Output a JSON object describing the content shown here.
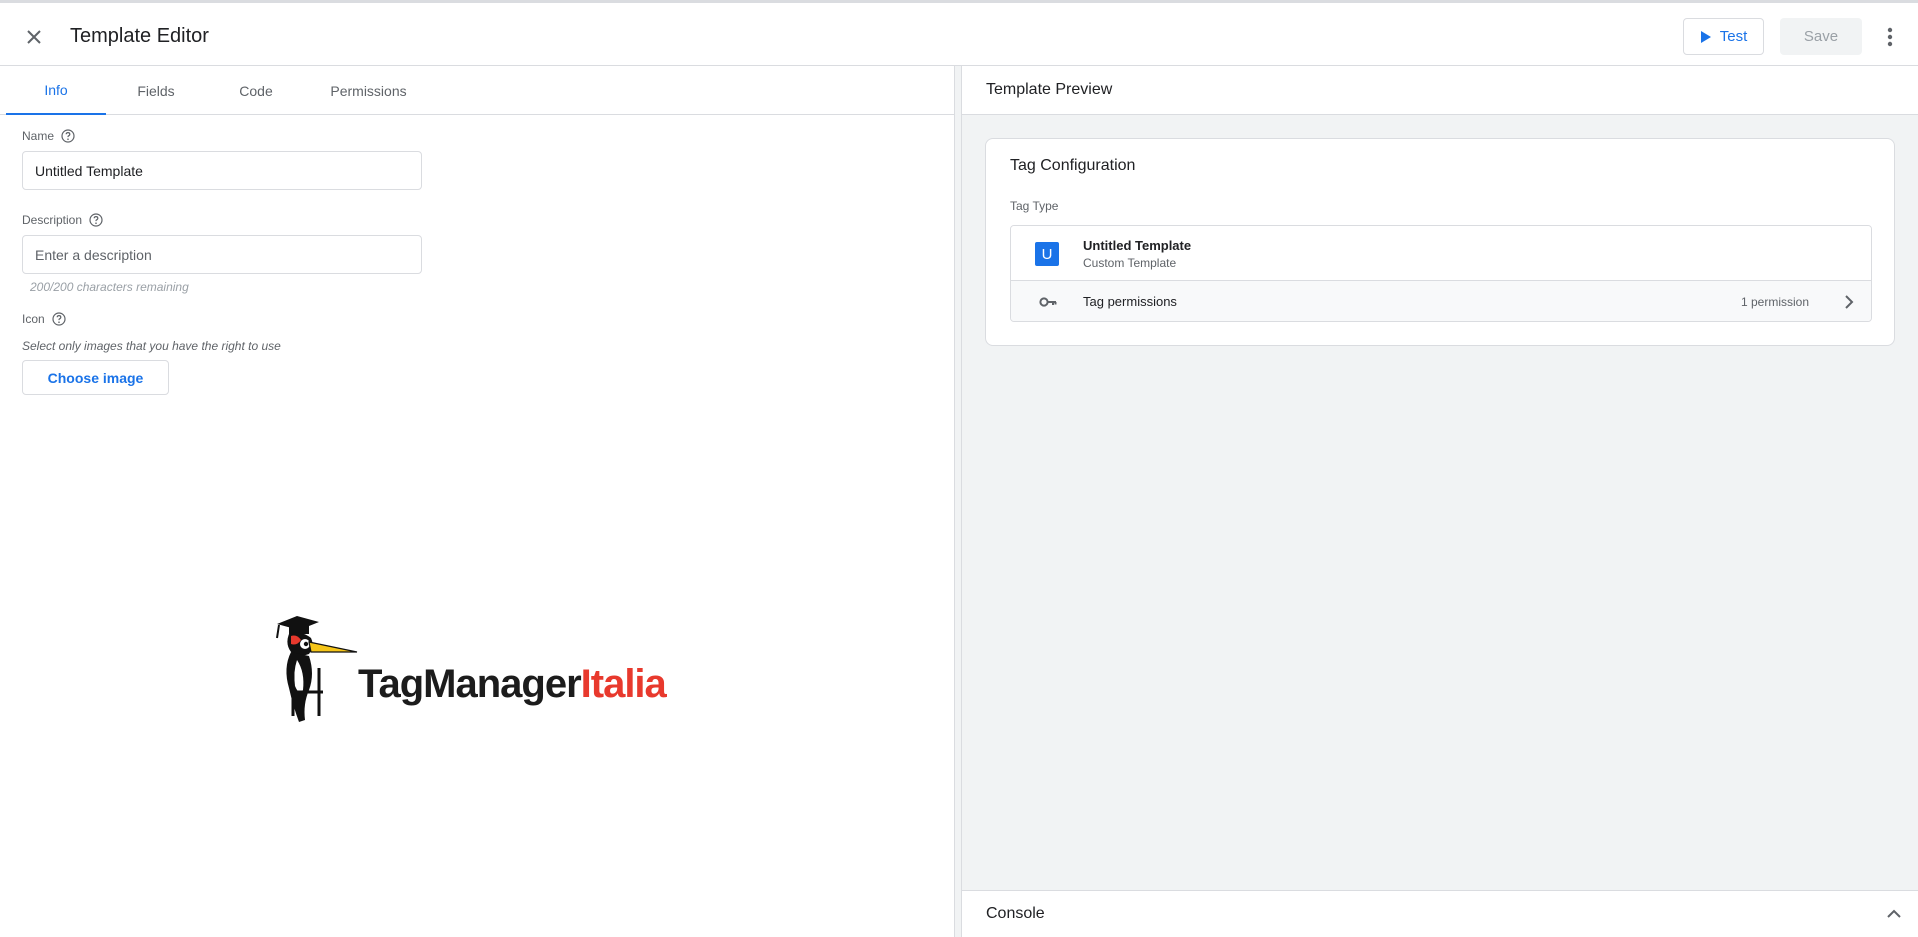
{
  "header": {
    "title": "Template Editor",
    "test_label": "Test",
    "save_label": "Save"
  },
  "tabs": [
    {
      "label": "Info",
      "active": true
    },
    {
      "label": "Fields",
      "active": false
    },
    {
      "label": "Code",
      "active": false
    },
    {
      "label": "Permissions",
      "active": false
    }
  ],
  "info": {
    "name_label": "Name",
    "name_value": "Untitled Template",
    "description_label": "Description",
    "description_placeholder": "Enter a description",
    "chars_remaining": "200/200 characters remaining",
    "icon_label": "Icon",
    "icon_hint": "Select only images that you have the right to use",
    "choose_image_label": "Choose image"
  },
  "logo": {
    "text_dark": "TagManager",
    "text_red": "Italia"
  },
  "preview": {
    "title": "Template Preview",
    "card_title": "Tag Configuration",
    "tag_type_label": "Tag Type",
    "badge_letter": "U",
    "tag_name": "Untitled Template",
    "tag_subtitle": "Custom Template",
    "permissions_label": "Tag permissions",
    "permissions_count": "1 permission"
  },
  "console": {
    "label": "Console"
  },
  "colors": {
    "accent": "#1a73e8",
    "brand_red": "#e8392d",
    "panel_bg": "#f1f3f4"
  }
}
